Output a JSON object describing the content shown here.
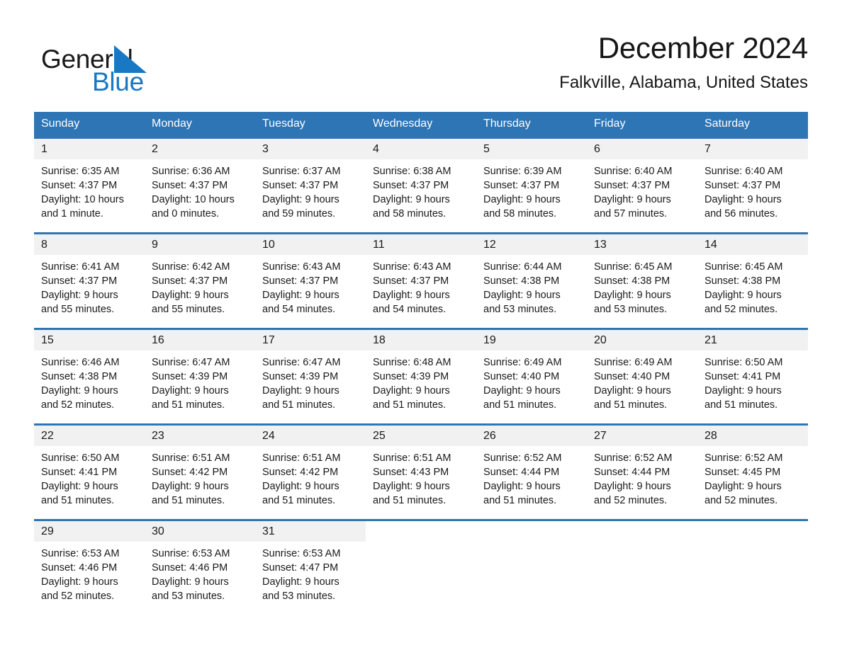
{
  "brand": {
    "word_one": "General",
    "word_two": "Blue",
    "triangle_icon": "triangle-icon",
    "colors": {
      "blue": "#1878C4",
      "black": "#1a1a1a"
    }
  },
  "header": {
    "month_title": "December 2024",
    "location": "Falkville, Alabama, United States"
  },
  "theme": {
    "header_blue": "#2E75B6",
    "daynum_band": "#F1F1F1",
    "text": "#1a1a1a"
  },
  "weekdays": [
    "Sunday",
    "Monday",
    "Tuesday",
    "Wednesday",
    "Thursday",
    "Friday",
    "Saturday"
  ],
  "labels": {
    "sunrise_prefix": "Sunrise:",
    "sunset_prefix": "Sunset:",
    "daylight_prefix": "Daylight:"
  },
  "weeks": [
    [
      {
        "day": "1",
        "sunrise": "Sunrise: 6:35 AM",
        "sunset": "Sunset: 4:37 PM",
        "daylight_1": "Daylight: 10 hours",
        "daylight_2": "and 1 minute."
      },
      {
        "day": "2",
        "sunrise": "Sunrise: 6:36 AM",
        "sunset": "Sunset: 4:37 PM",
        "daylight_1": "Daylight: 10 hours",
        "daylight_2": "and 0 minutes."
      },
      {
        "day": "3",
        "sunrise": "Sunrise: 6:37 AM",
        "sunset": "Sunset: 4:37 PM",
        "daylight_1": "Daylight: 9 hours",
        "daylight_2": "and 59 minutes."
      },
      {
        "day": "4",
        "sunrise": "Sunrise: 6:38 AM",
        "sunset": "Sunset: 4:37 PM",
        "daylight_1": "Daylight: 9 hours",
        "daylight_2": "and 58 minutes."
      },
      {
        "day": "5",
        "sunrise": "Sunrise: 6:39 AM",
        "sunset": "Sunset: 4:37 PM",
        "daylight_1": "Daylight: 9 hours",
        "daylight_2": "and 58 minutes."
      },
      {
        "day": "6",
        "sunrise": "Sunrise: 6:40 AM",
        "sunset": "Sunset: 4:37 PM",
        "daylight_1": "Daylight: 9 hours",
        "daylight_2": "and 57 minutes."
      },
      {
        "day": "7",
        "sunrise": "Sunrise: 6:40 AM",
        "sunset": "Sunset: 4:37 PM",
        "daylight_1": "Daylight: 9 hours",
        "daylight_2": "and 56 minutes."
      }
    ],
    [
      {
        "day": "8",
        "sunrise": "Sunrise: 6:41 AM",
        "sunset": "Sunset: 4:37 PM",
        "daylight_1": "Daylight: 9 hours",
        "daylight_2": "and 55 minutes."
      },
      {
        "day": "9",
        "sunrise": "Sunrise: 6:42 AM",
        "sunset": "Sunset: 4:37 PM",
        "daylight_1": "Daylight: 9 hours",
        "daylight_2": "and 55 minutes."
      },
      {
        "day": "10",
        "sunrise": "Sunrise: 6:43 AM",
        "sunset": "Sunset: 4:37 PM",
        "daylight_1": "Daylight: 9 hours",
        "daylight_2": "and 54 minutes."
      },
      {
        "day": "11",
        "sunrise": "Sunrise: 6:43 AM",
        "sunset": "Sunset: 4:37 PM",
        "daylight_1": "Daylight: 9 hours",
        "daylight_2": "and 54 minutes."
      },
      {
        "day": "12",
        "sunrise": "Sunrise: 6:44 AM",
        "sunset": "Sunset: 4:38 PM",
        "daylight_1": "Daylight: 9 hours",
        "daylight_2": "and 53 minutes."
      },
      {
        "day": "13",
        "sunrise": "Sunrise: 6:45 AM",
        "sunset": "Sunset: 4:38 PM",
        "daylight_1": "Daylight: 9 hours",
        "daylight_2": "and 53 minutes."
      },
      {
        "day": "14",
        "sunrise": "Sunrise: 6:45 AM",
        "sunset": "Sunset: 4:38 PM",
        "daylight_1": "Daylight: 9 hours",
        "daylight_2": "and 52 minutes."
      }
    ],
    [
      {
        "day": "15",
        "sunrise": "Sunrise: 6:46 AM",
        "sunset": "Sunset: 4:38 PM",
        "daylight_1": "Daylight: 9 hours",
        "daylight_2": "and 52 minutes."
      },
      {
        "day": "16",
        "sunrise": "Sunrise: 6:47 AM",
        "sunset": "Sunset: 4:39 PM",
        "daylight_1": "Daylight: 9 hours",
        "daylight_2": "and 51 minutes."
      },
      {
        "day": "17",
        "sunrise": "Sunrise: 6:47 AM",
        "sunset": "Sunset: 4:39 PM",
        "daylight_1": "Daylight: 9 hours",
        "daylight_2": "and 51 minutes."
      },
      {
        "day": "18",
        "sunrise": "Sunrise: 6:48 AM",
        "sunset": "Sunset: 4:39 PM",
        "daylight_1": "Daylight: 9 hours",
        "daylight_2": "and 51 minutes."
      },
      {
        "day": "19",
        "sunrise": "Sunrise: 6:49 AM",
        "sunset": "Sunset: 4:40 PM",
        "daylight_1": "Daylight: 9 hours",
        "daylight_2": "and 51 minutes."
      },
      {
        "day": "20",
        "sunrise": "Sunrise: 6:49 AM",
        "sunset": "Sunset: 4:40 PM",
        "daylight_1": "Daylight: 9 hours",
        "daylight_2": "and 51 minutes."
      },
      {
        "day": "21",
        "sunrise": "Sunrise: 6:50 AM",
        "sunset": "Sunset: 4:41 PM",
        "daylight_1": "Daylight: 9 hours",
        "daylight_2": "and 51 minutes."
      }
    ],
    [
      {
        "day": "22",
        "sunrise": "Sunrise: 6:50 AM",
        "sunset": "Sunset: 4:41 PM",
        "daylight_1": "Daylight: 9 hours",
        "daylight_2": "and 51 minutes."
      },
      {
        "day": "23",
        "sunrise": "Sunrise: 6:51 AM",
        "sunset": "Sunset: 4:42 PM",
        "daylight_1": "Daylight: 9 hours",
        "daylight_2": "and 51 minutes."
      },
      {
        "day": "24",
        "sunrise": "Sunrise: 6:51 AM",
        "sunset": "Sunset: 4:42 PM",
        "daylight_1": "Daylight: 9 hours",
        "daylight_2": "and 51 minutes."
      },
      {
        "day": "25",
        "sunrise": "Sunrise: 6:51 AM",
        "sunset": "Sunset: 4:43 PM",
        "daylight_1": "Daylight: 9 hours",
        "daylight_2": "and 51 minutes."
      },
      {
        "day": "26",
        "sunrise": "Sunrise: 6:52 AM",
        "sunset": "Sunset: 4:44 PM",
        "daylight_1": "Daylight: 9 hours",
        "daylight_2": "and 51 minutes."
      },
      {
        "day": "27",
        "sunrise": "Sunrise: 6:52 AM",
        "sunset": "Sunset: 4:44 PM",
        "daylight_1": "Daylight: 9 hours",
        "daylight_2": "and 52 minutes."
      },
      {
        "day": "28",
        "sunrise": "Sunrise: 6:52 AM",
        "sunset": "Sunset: 4:45 PM",
        "daylight_1": "Daylight: 9 hours",
        "daylight_2": "and 52 minutes."
      }
    ],
    [
      {
        "day": "29",
        "sunrise": "Sunrise: 6:53 AM",
        "sunset": "Sunset: 4:46 PM",
        "daylight_1": "Daylight: 9 hours",
        "daylight_2": "and 52 minutes."
      },
      {
        "day": "30",
        "sunrise": "Sunrise: 6:53 AM",
        "sunset": "Sunset: 4:46 PM",
        "daylight_1": "Daylight: 9 hours",
        "daylight_2": "and 53 minutes."
      },
      {
        "day": "31",
        "sunrise": "Sunrise: 6:53 AM",
        "sunset": "Sunset: 4:47 PM",
        "daylight_1": "Daylight: 9 hours",
        "daylight_2": "and 53 minutes."
      },
      null,
      null,
      null,
      null
    ]
  ]
}
